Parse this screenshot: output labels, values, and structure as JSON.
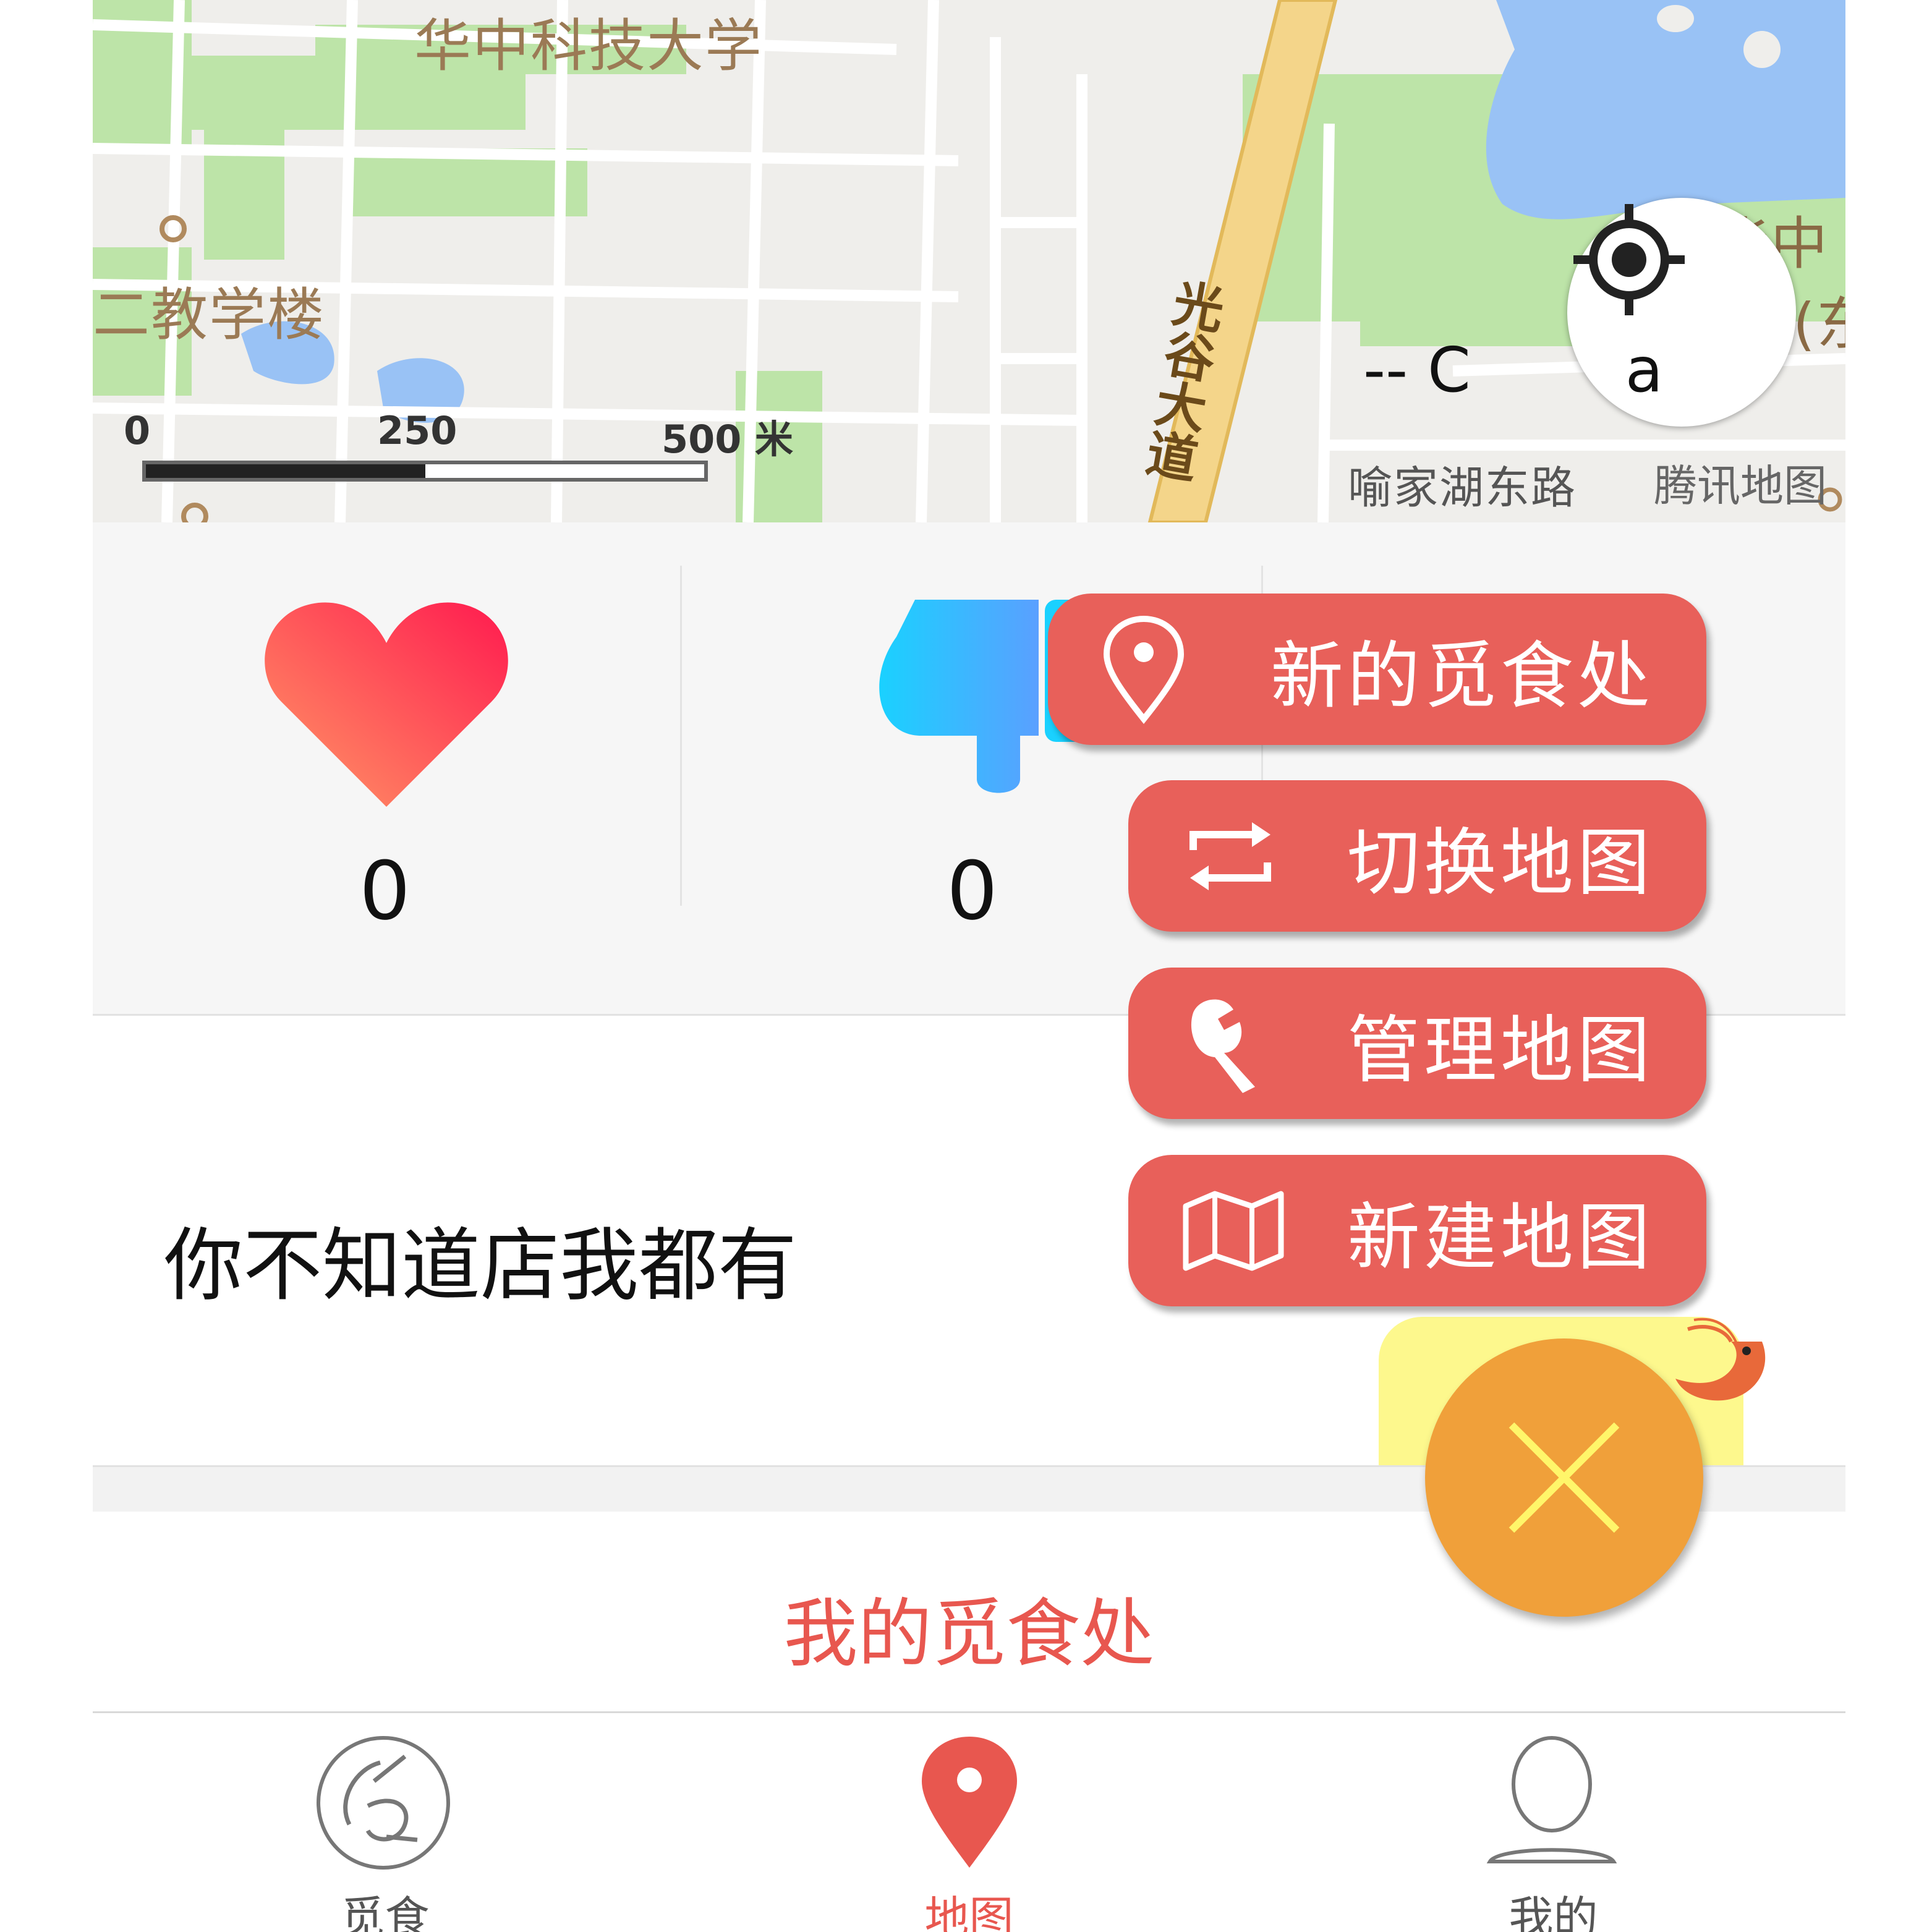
{
  "map": {
    "labels": {
      "university": "华中科技大学",
      "teaching_building": "二教学楼",
      "road": "光谷大道",
      "area_partial": "华中",
      "area_partial2": "(东",
      "yujiahu": "喻家湖东路"
    },
    "scale": {
      "min": "0",
      "mid": "250",
      "max": "500 米"
    },
    "attribution": "腾讯地图"
  },
  "stats": {
    "likes_count": "0",
    "dislikes_count": "0"
  },
  "quote": {
    "text": "你不知道店我都有",
    "author": "-- C",
    "author_suffix": "a"
  },
  "my_places_label": "我的觅食处",
  "fab_menu": {
    "items": [
      {
        "label": "新的觅食处",
        "icon": "map-pin-icon"
      },
      {
        "label": "切换地图",
        "icon": "swap-icon"
      },
      {
        "label": "管理地图",
        "icon": "wrench-icon"
      },
      {
        "label": "新建地图",
        "icon": "folded-map-icon"
      }
    ],
    "close_icon": "close-icon"
  },
  "tabbar": {
    "tabs": [
      {
        "label": "觅食",
        "icon": "food-logo-icon",
        "active": false
      },
      {
        "label": "地图",
        "icon": "map-pin-icon",
        "active": true
      },
      {
        "label": "我的",
        "icon": "user-icon",
        "active": false
      }
    ]
  },
  "colors": {
    "accent": "#e8574f",
    "fab_orange": "#f0a03a",
    "highlight": "#fdf88d",
    "map_road_major": "#f4d58a",
    "map_water": "#99c2f5",
    "map_green": "#bde4a8"
  }
}
